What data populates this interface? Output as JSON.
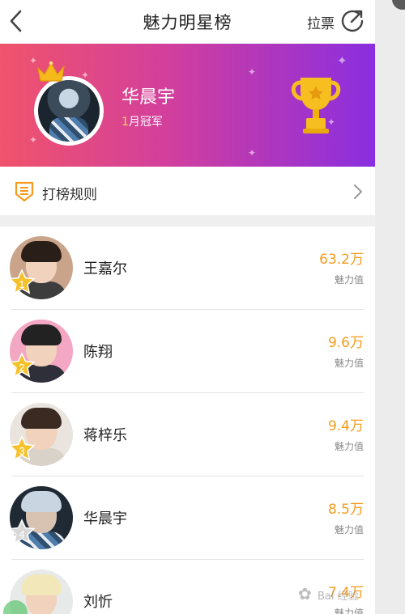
{
  "header": {
    "title": "魅力明星榜",
    "lapiao_label": "拉票",
    "icons": {
      "back": "back-arrow-icon",
      "share": "share-icon"
    }
  },
  "banner": {
    "champion_name": "华晨宇",
    "champion_month": "1",
    "champion_suffix": "月冠军",
    "colors": {
      "start": "#f0536b",
      "mid": "#d23f9d",
      "end": "#8a2ee0"
    },
    "icons": {
      "crown": "crown-icon",
      "trophy": "trophy-icon"
    }
  },
  "rules": {
    "label": "打榜规则",
    "icon": "rules-badge-icon"
  },
  "ranking": [
    {
      "rank": "1",
      "name": "王嘉尔",
      "score": "63.2万",
      "score_label": "魅力值"
    },
    {
      "rank": "2",
      "name": "陈翔",
      "score": "9.6万",
      "score_label": "魅力值"
    },
    {
      "rank": "3",
      "name": "蒋梓乐",
      "score": "9.4万",
      "score_label": "魅力值"
    },
    {
      "rank": "4",
      "name": "华晨宇",
      "score": "8.5万",
      "score_label": "魅力值"
    },
    {
      "rank": "",
      "name": "刘忻",
      "score": "7.4万",
      "score_label": "魅力值"
    }
  ],
  "watermark": {
    "text": "Bai 经验"
  },
  "colors": {
    "accent": "#f39c1e",
    "gold_badge": "#f5c22b",
    "silver_badge": "#d8d8d8"
  }
}
